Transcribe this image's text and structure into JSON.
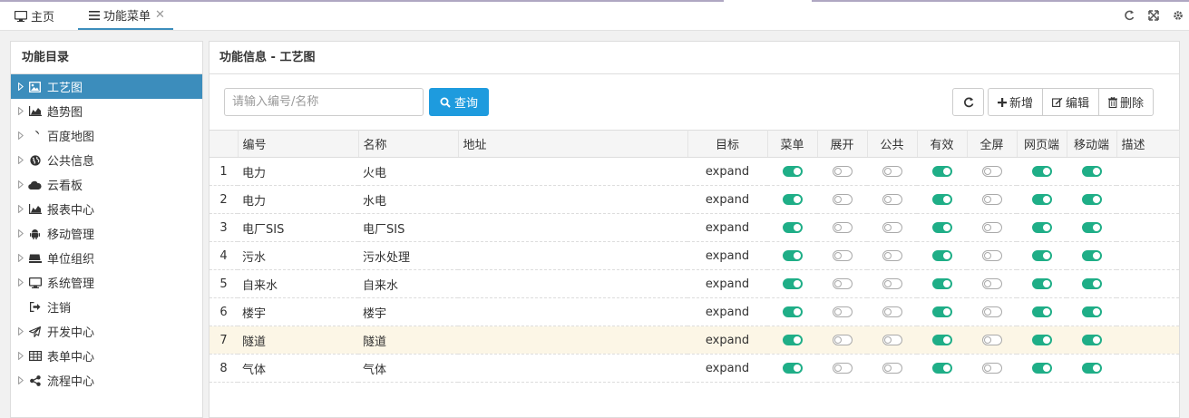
{
  "tabs": {
    "home": "主页",
    "active": "功能菜单",
    "close": "✕"
  },
  "sidebar": {
    "title": "功能目录",
    "items": [
      {
        "label": "工艺图",
        "icon": "image-icon",
        "expandable": true,
        "active": true
      },
      {
        "label": "趋势图",
        "icon": "area-chart-icon",
        "expandable": true
      },
      {
        "label": "百度地图",
        "icon": "map-marker-icon",
        "expandable": true
      },
      {
        "label": "公共信息",
        "icon": "globe-icon",
        "expandable": true
      },
      {
        "label": "云看板",
        "icon": "cloud-icon",
        "expandable": true
      },
      {
        "label": "报表中心",
        "icon": "area-chart-icon",
        "expandable": true
      },
      {
        "label": "移动管理",
        "icon": "android-icon",
        "expandable": true
      },
      {
        "label": "单位组织",
        "icon": "keyboard-icon",
        "expandable": true
      },
      {
        "label": "系统管理",
        "icon": "desktop-icon",
        "expandable": true
      },
      {
        "label": "注销",
        "icon": "sign-out-icon",
        "expandable": false
      },
      {
        "label": "开发中心",
        "icon": "paper-plane-icon",
        "expandable": true
      },
      {
        "label": "表单中心",
        "icon": "table-icon",
        "expandable": true
      },
      {
        "label": "流程中心",
        "icon": "share-icon",
        "expandable": true
      }
    ]
  },
  "main": {
    "title": "功能信息 - 工艺图",
    "search": {
      "placeholder": "请输入编号/名称",
      "value": ""
    },
    "query_label": "查询",
    "add_label": "新增",
    "edit_label": "编辑",
    "delete_label": "删除"
  },
  "table": {
    "columns": [
      "",
      "编号",
      "名称",
      "地址",
      "目标",
      "菜单",
      "展开",
      "公共",
      "有效",
      "全屏",
      "网页端",
      "移动端",
      "描述"
    ],
    "rows": [
      {
        "n": "1",
        "code": "电力",
        "name": "火电",
        "addr": "",
        "target": "expand",
        "toggles": [
          true,
          false,
          false,
          true,
          false,
          true,
          true
        ]
      },
      {
        "n": "2",
        "code": "电力",
        "name": "水电",
        "addr": "",
        "target": "expand",
        "toggles": [
          true,
          false,
          false,
          true,
          false,
          true,
          true
        ]
      },
      {
        "n": "3",
        "code": "电厂SIS",
        "name": "电厂SIS",
        "addr": "",
        "target": "expand",
        "toggles": [
          true,
          false,
          false,
          true,
          false,
          true,
          true
        ]
      },
      {
        "n": "4",
        "code": "污水",
        "name": "污水处理",
        "addr": "",
        "target": "expand",
        "toggles": [
          true,
          false,
          false,
          true,
          false,
          true,
          true
        ]
      },
      {
        "n": "5",
        "code": "自来水",
        "name": "自来水",
        "addr": "",
        "target": "expand",
        "toggles": [
          true,
          false,
          false,
          true,
          false,
          true,
          true
        ]
      },
      {
        "n": "6",
        "code": "楼宇",
        "name": "楼宇",
        "addr": "",
        "target": "expand",
        "toggles": [
          true,
          false,
          false,
          true,
          false,
          true,
          true
        ]
      },
      {
        "n": "7",
        "code": "隧道",
        "name": "隧道",
        "addr": "",
        "target": "expand",
        "toggles": [
          true,
          false,
          false,
          true,
          false,
          true,
          true
        ],
        "highlight": true
      },
      {
        "n": "8",
        "code": "气体",
        "name": "气体",
        "addr": "",
        "target": "expand",
        "toggles": [
          true,
          false,
          false,
          true,
          false,
          true,
          true
        ]
      }
    ]
  },
  "colors": {
    "accent": "#3c8dbc",
    "query": "#1e9bde",
    "toggle_on": "#1fae87",
    "row_highlight": "#fcf6e6"
  }
}
